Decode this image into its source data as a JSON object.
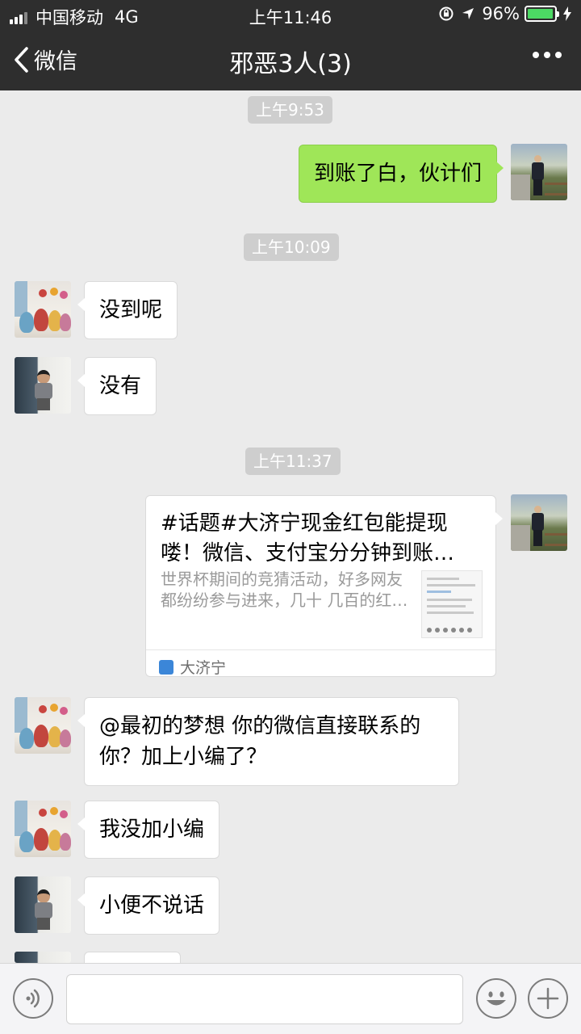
{
  "status_bar": {
    "carrier": "中国移动",
    "network": "4G",
    "time": "上午11:46",
    "battery_percent": "96%",
    "battery_level": 0.96,
    "icons": [
      "signal-icon",
      "orientation-lock-icon",
      "location-icon",
      "battery-icon",
      "charging-icon"
    ]
  },
  "nav": {
    "back_label": "微信",
    "title": "邪恶3人(3)",
    "icons": [
      "back-chevron-icon",
      "more-icon"
    ]
  },
  "messages": {
    "ts1": "上午9:53",
    "msg1": "到账了白，伙计们",
    "ts2": "上午10:09",
    "msg2": "没到呢",
    "msg3": "没有",
    "ts3": "上午11:37",
    "card": {
      "title": "#话题#大济宁现金红包能提现喽！微信、支付宝分分钟到账…",
      "description": "世界杯期间的竞猜活动，好多网友都纷纷参与进来，几十 几百的红…",
      "source": "大济宁"
    },
    "msg4": "@最初的梦想 你的微信直接联系的你？加上小编了？",
    "msg5": "我没加小编",
    "msg6": "小便不说话"
  },
  "input_bar": {
    "placeholder": "",
    "icons": [
      "voice-icon",
      "emoji-icon",
      "plus-icon"
    ]
  },
  "colors": {
    "nav_bg": "#2e2e2e",
    "chat_bg": "#ebebeb",
    "self_bubble": "#9fe658",
    "other_bubble": "#ffffff",
    "battery": "#4cd964"
  }
}
